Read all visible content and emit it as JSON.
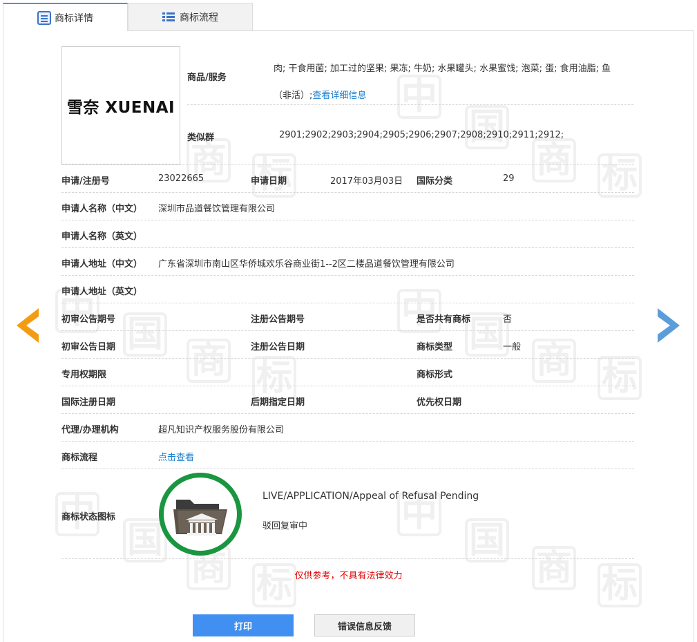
{
  "tabs": [
    {
      "label": "商标详情",
      "icon": "document-icon"
    },
    {
      "label": "商标流程",
      "icon": "list-icon"
    }
  ],
  "logo": {
    "text": "雪奈 XUENAI"
  },
  "goods": {
    "label": "商品/服务",
    "line1": "肉; 干食用菌; 加工过的坚果; 果冻; 牛奶; 水果罐头; 水果蜜饯; 泡菜; 蛋; 食用油脂; 鱼",
    "line2_text": "（非活）;",
    "line2_link": "查看详细信息"
  },
  "similar_group": {
    "label": "类似群",
    "value": "2901;2902;2903;2904;2905;2906;2907;2908;2910;2911;2912;"
  },
  "fields": {
    "reg_no_label": "申请/注册号",
    "reg_no": "23022665",
    "app_date_label": "申请日期",
    "app_date": "2017年03月03日",
    "intl_class_label": "国际分类",
    "intl_class": "29",
    "applicant_cn_label": "申请人名称（中文）",
    "applicant_cn": "深圳市品道餐饮管理有限公司",
    "applicant_en_label": "申请人名称（英文）",
    "address_cn_label": "申请人地址（中文）",
    "address_cn": "广东省深圳市南山区华侨城欢乐谷商业街1--2区二楼品道餐饮管理有限公司",
    "address_en_label": "申请人地址（英文）",
    "prelim_pub_no_label": "初审公告期号",
    "reg_pub_no_label": "注册公告期号",
    "shared_label": "是否共有商标",
    "shared": "否",
    "prelim_pub_date_label": "初审公告日期",
    "reg_pub_date_label": "注册公告日期",
    "tm_type_label": "商标类型",
    "tm_type": "一般",
    "exclusive_period_label": "专用权期限",
    "tm_form_label": "商标形式",
    "intl_reg_date_label": "国际注册日期",
    "later_date_label": "后期指定日期",
    "priority_date_label": "优先权日期",
    "agent_label": "代理/办理机构",
    "agent": "超凡知识产权服务股份有限公司",
    "flow_label": "商标流程",
    "flow_link": "点击查看"
  },
  "status": {
    "label": "商标状态图标",
    "en": "LIVE/APPLICATION/Appeal of Refusal Pending",
    "cn": "驳回复审中",
    "icon": "folder-court-icon",
    "ring_color": "#1a9641"
  },
  "disclaimer": "仅供参考，不具有法律效力",
  "buttons": {
    "print": "打印",
    "feedback": "错误信息反馈"
  },
  "watermark_chars": [
    "中",
    "国",
    "商",
    "标"
  ],
  "colors": {
    "accent": "#4190f1",
    "link": "#1a7fd0",
    "prev_arrow": "#f39c12",
    "next_arrow": "#5b9ddb",
    "disclaimer": "#e60000"
  }
}
